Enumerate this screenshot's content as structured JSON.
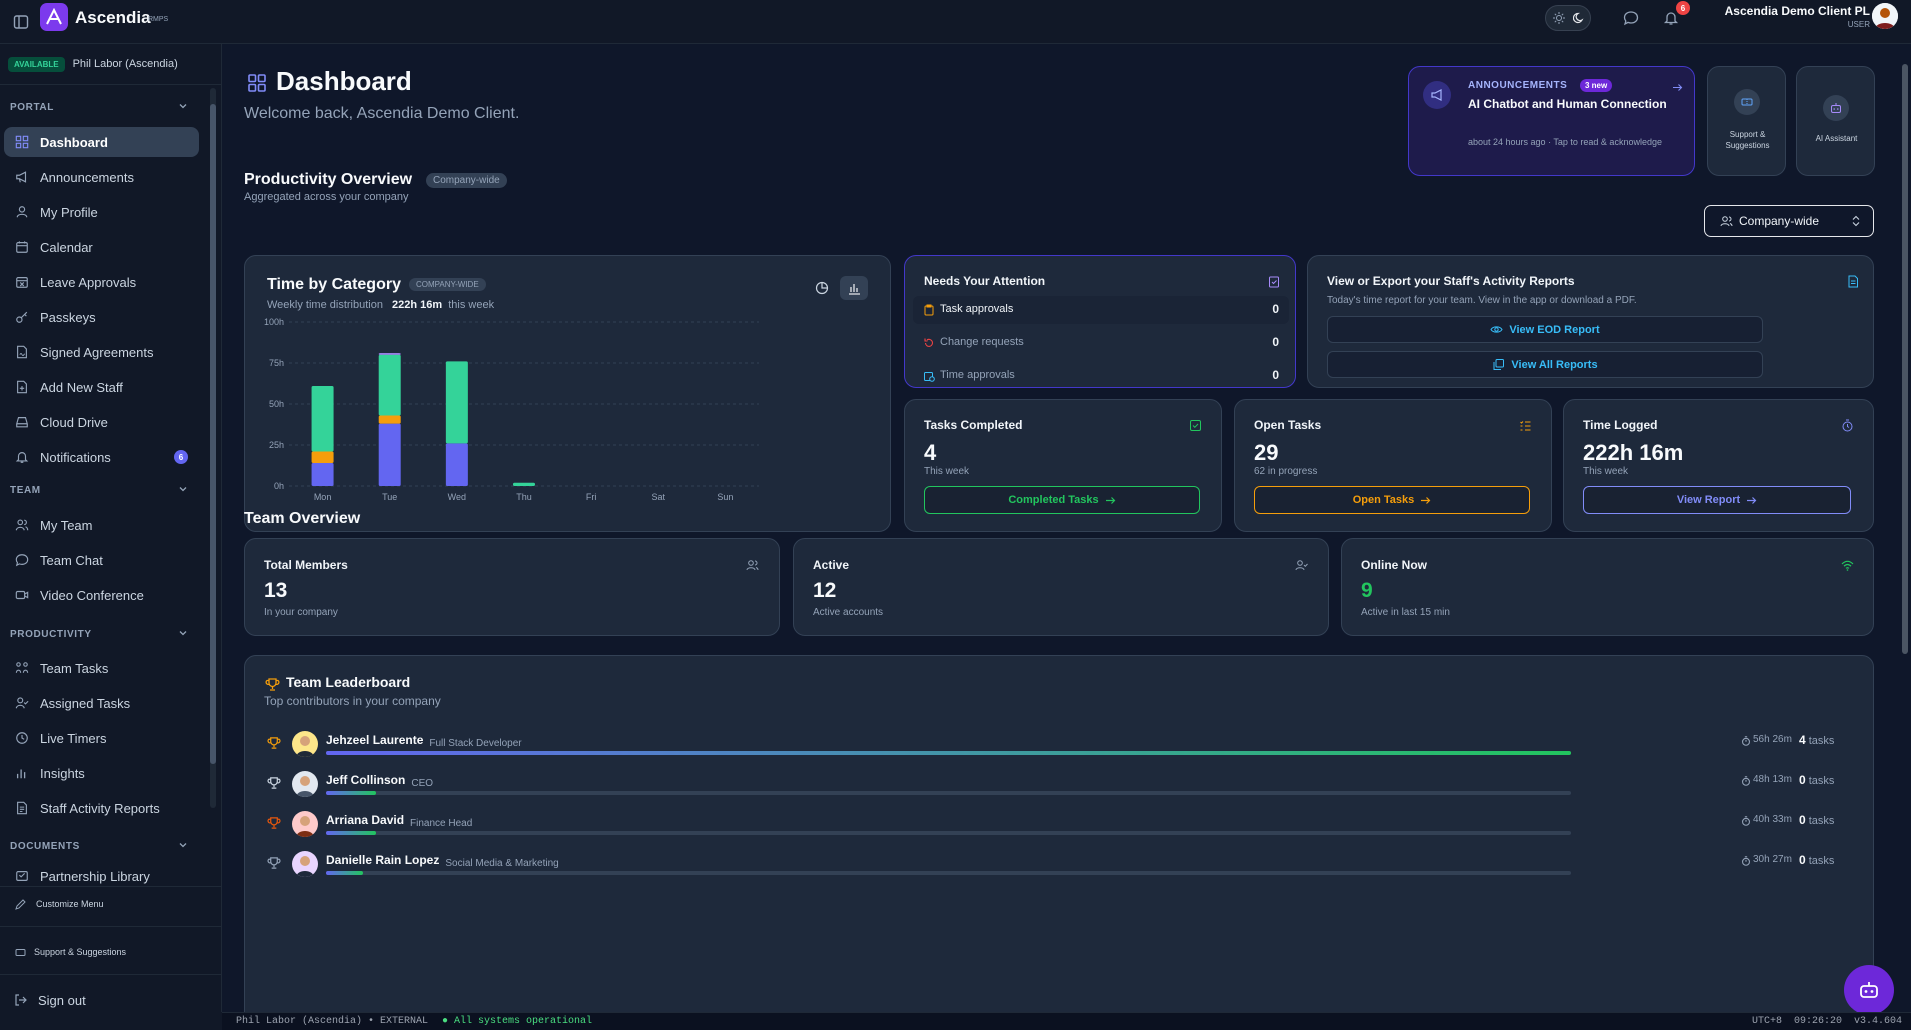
{
  "app": {
    "name": "Ascendia",
    "suffix": "RMPS"
  },
  "user": {
    "name": "Ascendia Demo Client PL",
    "role": "USER",
    "notifications": "6"
  },
  "presence": {
    "status": "AVAILABLE",
    "label": "Phil Labor (Ascendia)"
  },
  "sidebar": {
    "sections": [
      {
        "title": "PORTAL"
      },
      {
        "title": "TEAM"
      },
      {
        "title": "PRODUCTIVITY"
      },
      {
        "title": "DOCUMENTS"
      }
    ],
    "portal_items": [
      {
        "label": "Dashboard",
        "icon": "dashboard-icon"
      },
      {
        "label": "Announcements",
        "icon": "megaphone-icon"
      },
      {
        "label": "My Profile",
        "icon": "user-icon"
      },
      {
        "label": "Calendar",
        "icon": "calendar-icon"
      },
      {
        "label": "Leave Approvals",
        "icon": "calendar-x-icon"
      },
      {
        "label": "Passkeys",
        "icon": "key-icon"
      },
      {
        "label": "Signed Agreements",
        "icon": "file-signed-icon"
      },
      {
        "label": "Add New Staff",
        "icon": "file-plus-icon"
      },
      {
        "label": "Cloud Drive",
        "icon": "drive-icon"
      },
      {
        "label": "Notifications",
        "icon": "bell-icon",
        "badge": "6"
      }
    ],
    "team_items": [
      {
        "label": "My Team",
        "icon": "users-icon"
      },
      {
        "label": "Team Chat",
        "icon": "chat-icon"
      },
      {
        "label": "Video Conference",
        "icon": "video-icon"
      }
    ],
    "productivity_items": [
      {
        "label": "Team Tasks",
        "icon": "tasks-icon"
      },
      {
        "label": "Assigned Tasks",
        "icon": "user-check-icon"
      },
      {
        "label": "Live Timers",
        "icon": "clock-icon"
      },
      {
        "label": "Insights",
        "icon": "bar-chart-icon"
      },
      {
        "label": "Staff Activity Reports",
        "icon": "report-icon"
      }
    ],
    "documents_items": [
      {
        "label": "Partnership Library",
        "icon": "library-icon"
      }
    ],
    "customize": "Customize Menu",
    "support": "Support & Suggestions",
    "signout": "Sign out"
  },
  "header": {
    "title": "Dashboard",
    "welcome": "Welcome back, Ascendia Demo Client."
  },
  "announcement": {
    "kicker": "ANNOUNCEMENTS",
    "badge": "3 new",
    "title": "AI Chatbot and Human Connection",
    "meta": "about 24 hours ago · Tap to read & acknowledge"
  },
  "quick": {
    "support": "Support & Suggestions",
    "ai": "AI Assistant"
  },
  "productivity": {
    "title": "Productivity Overview",
    "pill": "Company-wide",
    "sub": "Aggregated across your company",
    "scope_select": "Company-wide"
  },
  "time_by_category": {
    "title": "Time by Category",
    "pill": "COMPANY-WIDE",
    "sub_prefix": "Weekly time distribution",
    "total": "222h 16m",
    "sub_suffix": "this week"
  },
  "chart_data": {
    "type": "bar",
    "stacked": true,
    "categories": [
      "Mon",
      "Tue",
      "Wed",
      "Thu",
      "Fri",
      "Sat",
      "Sun"
    ],
    "y_ticks": [
      "0h",
      "25h",
      "50h",
      "75h",
      "100h"
    ],
    "ylim": [
      0,
      100
    ],
    "series": [
      {
        "values": [
          14,
          38,
          26,
          0,
          0,
          0,
          0
        ],
        "color": "#6366f1"
      },
      {
        "values": [
          7,
          5,
          0,
          0,
          0,
          0,
          0
        ],
        "color": "#f59e0b"
      },
      {
        "values": [
          40,
          37,
          50,
          2,
          0,
          0,
          0
        ],
        "color": "#34d399"
      },
      {
        "values": [
          0,
          1,
          0,
          0,
          0,
          0,
          0
        ],
        "color": "#a78bfa"
      }
    ],
    "grid": true
  },
  "attention": {
    "title": "Needs Your Attention",
    "rows": [
      {
        "label": "Task approvals",
        "count": "0"
      },
      {
        "label": "Change requests",
        "count": "0"
      },
      {
        "label": "Time approvals",
        "count": "0"
      }
    ]
  },
  "reports": {
    "title": "View or Export your Staff's Activity Reports",
    "sub": "Today's time report for your team. View in the app or download a PDF.",
    "eod": "View EOD Report",
    "all": "View All Reports"
  },
  "kpis": [
    {
      "title": "Tasks Completed",
      "value": "4",
      "sub": "This week",
      "button": "Completed Tasks",
      "color": "#22c55e"
    },
    {
      "title": "Open Tasks",
      "value": "29",
      "sub": "62 in progress",
      "button": "Open Tasks",
      "color": "#f59e0b"
    },
    {
      "title": "Time Logged",
      "value": "222h 16m",
      "sub": "This week",
      "button": "View Report",
      "color": "#818cf8"
    }
  ],
  "team_overview": {
    "title": "Team Overview",
    "cards": [
      {
        "title": "Total Members",
        "value": "13",
        "sub": "In your company"
      },
      {
        "title": "Active",
        "value": "12",
        "sub": "Active accounts"
      },
      {
        "title": "Online Now",
        "value": "9",
        "sub": "Active in last 15 min"
      }
    ]
  },
  "leaderboard": {
    "title": "Team Leaderboard",
    "sub": "Top contributors in your company",
    "tasks_word": "tasks",
    "rows": [
      {
        "name": "Jehzeel Laurente",
        "role": "Full Stack Developer",
        "time": "56h 26m",
        "tasks": "4",
        "progress": 1.0,
        "trophy": "#f59e0b"
      },
      {
        "name": "Jeff Collinson",
        "role": "CEO",
        "time": "48h 13m",
        "tasks": "0",
        "progress": 0.04,
        "trophy": "#cbd5e1"
      },
      {
        "name": "Arriana David",
        "role": "Finance Head",
        "time": "40h 33m",
        "tasks": "0",
        "progress": 0.04,
        "trophy": "#ea580c"
      },
      {
        "name": "Danielle Rain Lopez",
        "role": "Social Media & Marketing",
        "time": "30h 27m",
        "tasks": "0",
        "progress": 0.03,
        "trophy": "#94a3b8"
      }
    ]
  },
  "status": {
    "left": "Phil Labor (Ascendia) • EXTERNAL",
    "ok": "● All systems operational",
    "right": "UTC+8  09:26:20  v3.4.604"
  }
}
